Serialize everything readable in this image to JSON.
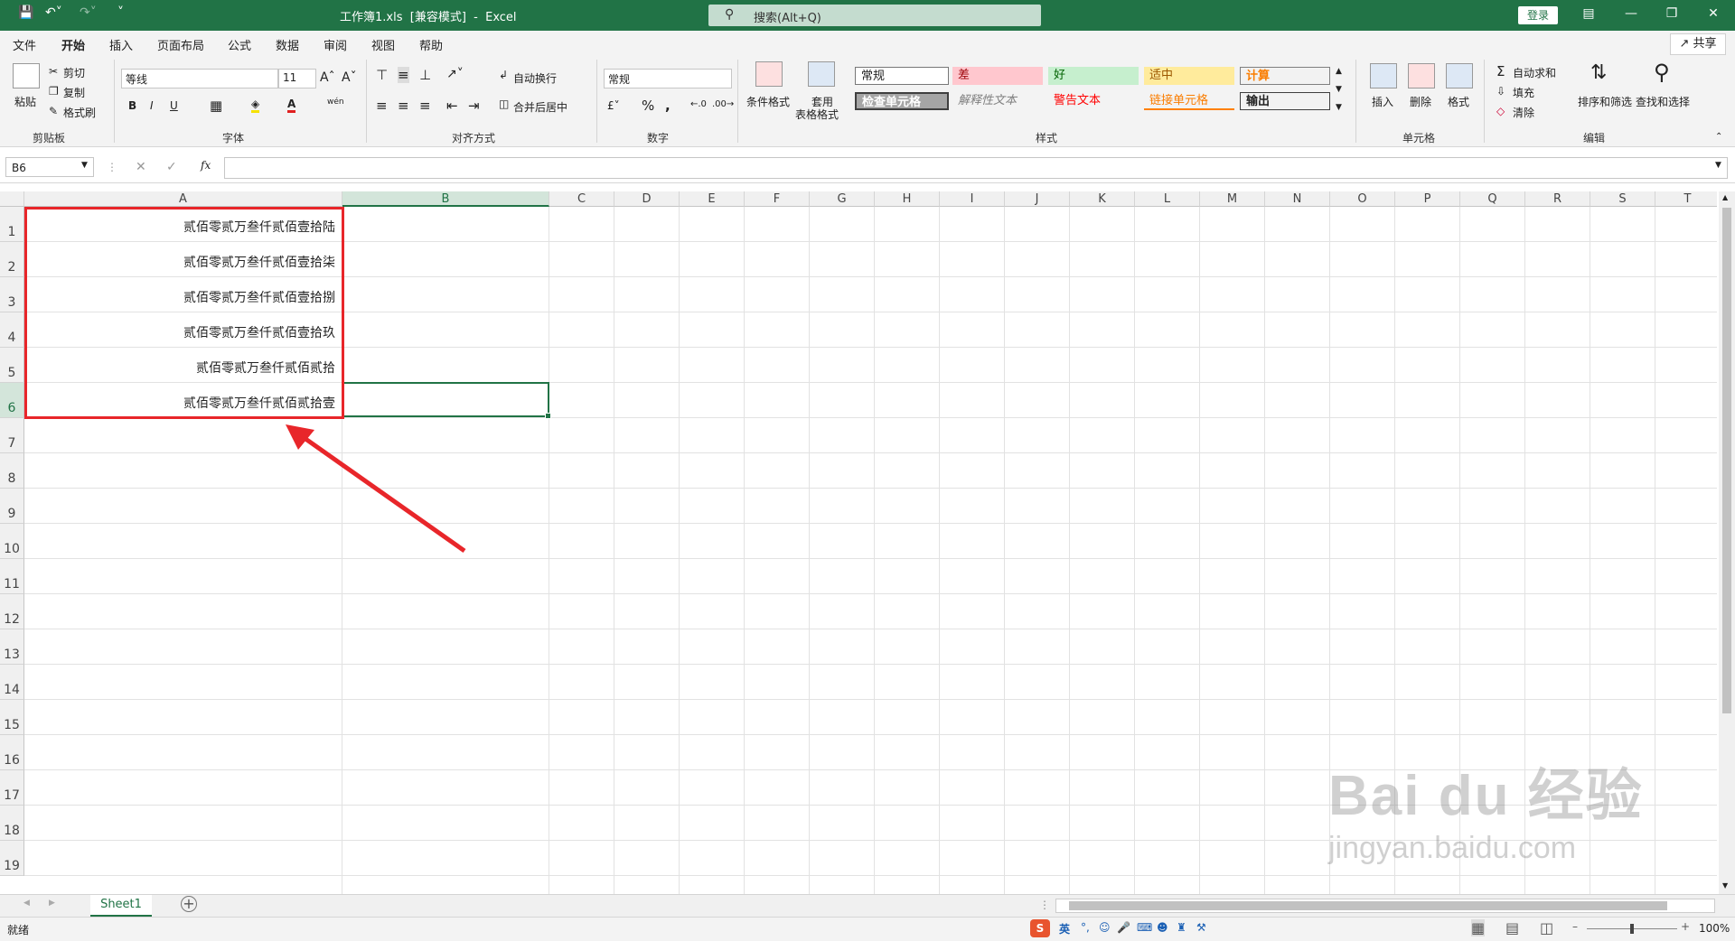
{
  "window": {
    "title": "工作簿1.xls  [兼容模式]  -  Excel",
    "search_placeholder": "搜索(Alt+Q)",
    "login": "登录"
  },
  "menu": {
    "tabs": [
      "文件",
      "开始",
      "插入",
      "页面布局",
      "公式",
      "数据",
      "审阅",
      "视图",
      "帮助"
    ],
    "active_tab": "开始",
    "share": "共享"
  },
  "ribbon": {
    "clipboard": {
      "paste": "粘贴",
      "cut": "剪切",
      "copy": "复制",
      "format_painter": "格式刷",
      "label": "剪贴板"
    },
    "font": {
      "name": "等线",
      "size": "11",
      "label": "字体"
    },
    "alignment": {
      "wrap": "自动换行",
      "merge": "合并后居中",
      "label": "对齐方式"
    },
    "number": {
      "format": "常规",
      "label": "数字"
    },
    "styles": {
      "cond_format": "条件格式",
      "table_format_1": "套用",
      "table_format_2": "表格格式",
      "cells": [
        "常规",
        "差",
        "好",
        "适中",
        "计算",
        "检查单元格",
        "解释性文本",
        "警告文本",
        "链接单元格",
        "输出"
      ],
      "label": "样式"
    },
    "cells": {
      "insert": "插入",
      "delete": "删除",
      "format": "格式",
      "label": "单元格"
    },
    "editing": {
      "autosum": "自动求和",
      "fill": "填充",
      "clear": "清除",
      "sort_filter": "排序和筛选",
      "find_select": "查找和选择",
      "label": "编辑"
    }
  },
  "formula_bar": {
    "name_box": "B6",
    "fx": "fx",
    "value": ""
  },
  "grid": {
    "columns": [
      "A",
      "B",
      "C",
      "D",
      "E",
      "F",
      "G",
      "H",
      "I",
      "J",
      "K",
      "L",
      "M",
      "N",
      "O",
      "P",
      "Q",
      "R",
      "S",
      "T"
    ],
    "rows": [
      "1",
      "2",
      "3",
      "4",
      "5",
      "6",
      "7",
      "8",
      "9",
      "10",
      "11",
      "12",
      "13",
      "14",
      "15",
      "16",
      "17",
      "18",
      "19"
    ],
    "selected_column": "B",
    "selected_row": "6",
    "a_values": [
      "贰佰零贰万叁仟贰佰壹拾陆",
      "贰佰零贰万叁仟贰佰壹拾柒",
      "贰佰零贰万叁仟贰佰壹拾捌",
      "贰佰零贰万叁仟贰佰壹拾玖",
      "贰佰零贰万叁仟贰佰贰拾",
      "贰佰零贰万叁仟贰佰贰拾壹"
    ]
  },
  "sheets": {
    "tabs": [
      "Sheet1"
    ],
    "add": "+"
  },
  "status": {
    "ready": "就绪",
    "zoom": "100%",
    "ime": "英"
  },
  "watermark": {
    "brand": "Bai du 经验",
    "url": "jingyan.baidu.com"
  },
  "colors": {
    "accent": "#217346",
    "annotation": "#e8262a"
  }
}
